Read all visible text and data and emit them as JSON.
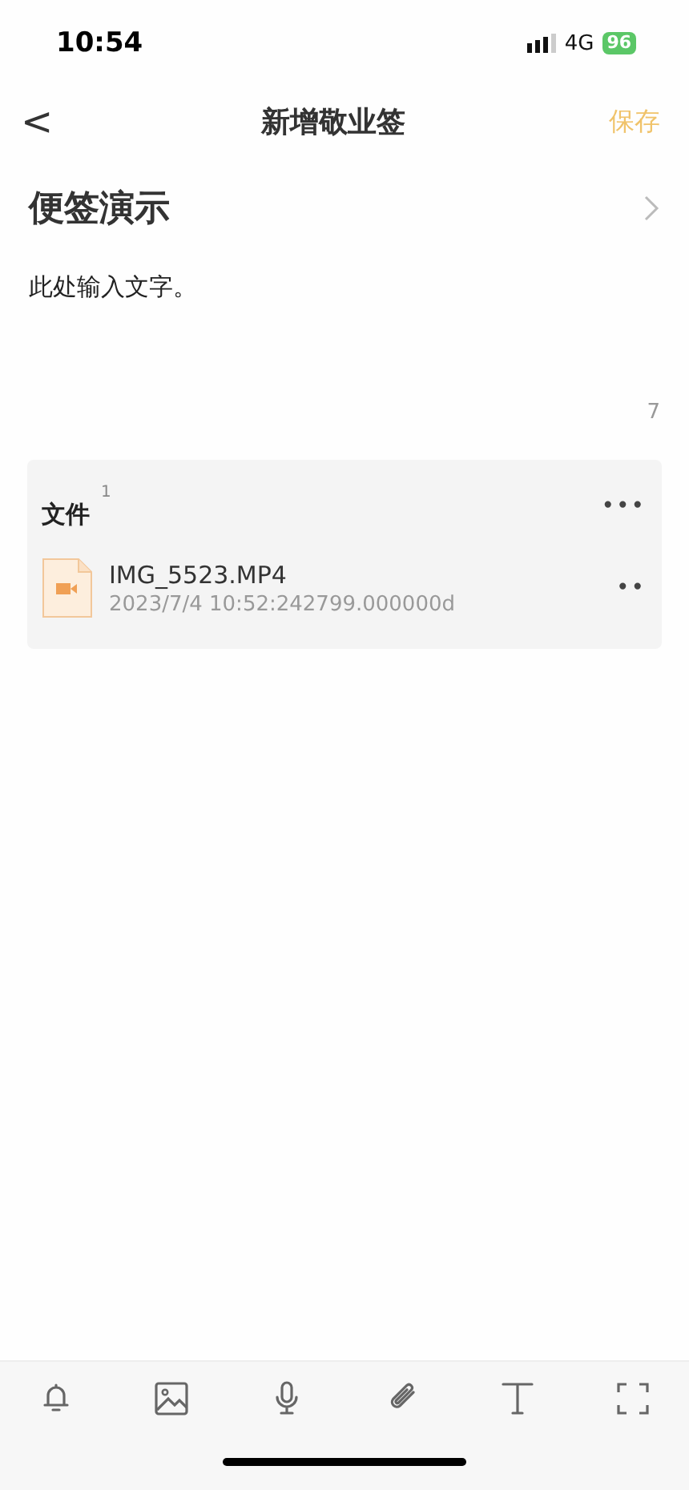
{
  "status_bar": {
    "time": "10:54",
    "network": "4G",
    "battery": "96"
  },
  "nav": {
    "back": "<",
    "title": "新增敬业签",
    "action": "保存"
  },
  "note": {
    "title": "便签演示",
    "body": "此处输入文字。",
    "char_count": "7"
  },
  "files": {
    "heading": "文件",
    "count": "1",
    "more": "•••",
    "items": [
      {
        "kind": "video",
        "name": "IMG_5523.MP4",
        "meta": "2023/7/4 10:52:242799.000000d",
        "more": "••"
      }
    ]
  },
  "toolbar": [
    {
      "kind": "bell"
    },
    {
      "kind": "image"
    },
    {
      "kind": "mic"
    },
    {
      "kind": "clip"
    },
    {
      "kind": "text"
    },
    {
      "kind": "expand"
    }
  ]
}
